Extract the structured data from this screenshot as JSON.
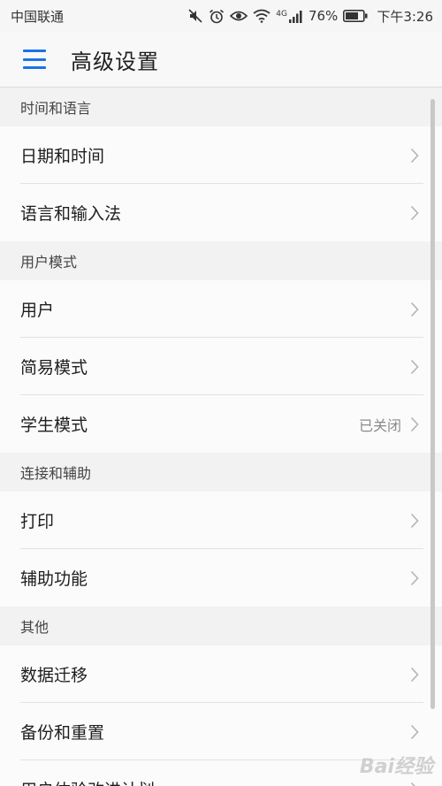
{
  "status_bar": {
    "carrier": "中国联通",
    "network": "4G",
    "battery": "76%",
    "time": "下午3:26",
    "icons": [
      "mute-icon",
      "alarm-icon",
      "eye-comfort-icon",
      "wifi-icon",
      "signal-icon",
      "battery-icon"
    ]
  },
  "app_bar": {
    "menu_icon": "hamburger-menu-icon",
    "title": "高级设置",
    "accent_color": "#1a73e8"
  },
  "sections": [
    {
      "header": "时间和语言",
      "items": [
        {
          "label": "日期和时间",
          "value": ""
        },
        {
          "label": "语言和输入法",
          "value": ""
        }
      ]
    },
    {
      "header": "用户模式",
      "items": [
        {
          "label": "用户",
          "value": ""
        },
        {
          "label": "简易模式",
          "value": ""
        },
        {
          "label": "学生模式",
          "value": "已关闭"
        }
      ]
    },
    {
      "header": "连接和辅助",
      "items": [
        {
          "label": "打印",
          "value": ""
        },
        {
          "label": "辅助功能",
          "value": ""
        }
      ]
    },
    {
      "header": "其他",
      "items": [
        {
          "label": "数据迁移",
          "value": ""
        },
        {
          "label": "备份和重置",
          "value": ""
        },
        {
          "label": "用户体验改进计划",
          "value": ""
        }
      ]
    }
  ],
  "watermark": "Bai经验"
}
